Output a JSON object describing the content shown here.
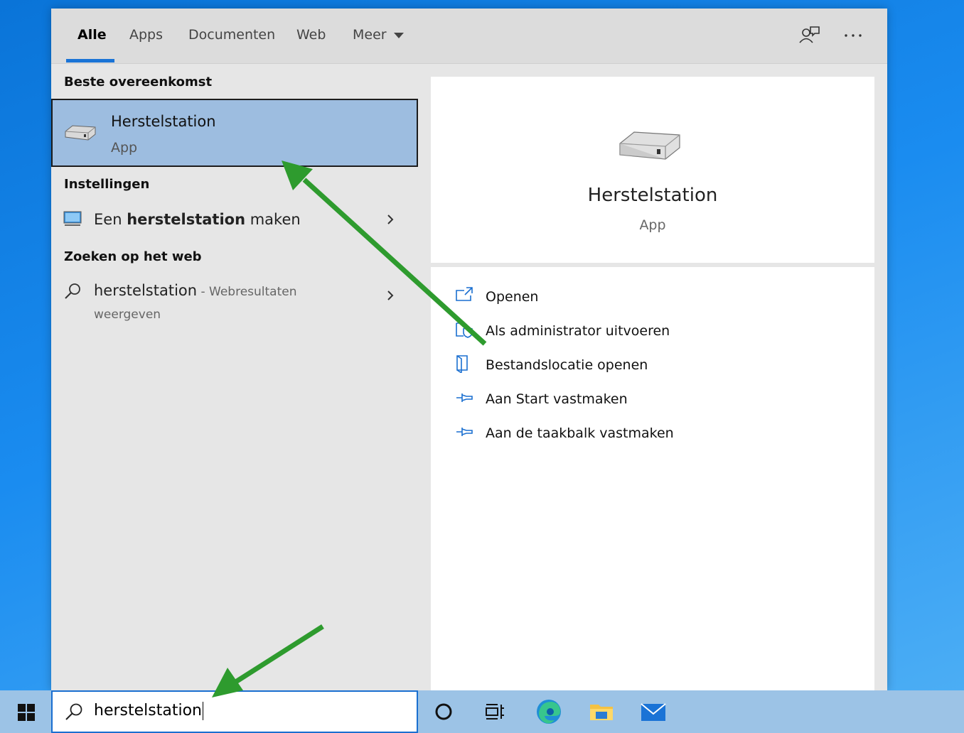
{
  "tabs": [
    {
      "label": "Alle"
    },
    {
      "label": "Apps"
    },
    {
      "label": "Documenten"
    },
    {
      "label": "Web"
    },
    {
      "label": "Meer"
    }
  ],
  "sections": {
    "best_match": "Beste overeenkomst",
    "settings": "Instellingen",
    "web": "Zoeken op het web"
  },
  "best_result": {
    "title": "Herstelstation",
    "subtitle": "App"
  },
  "settings_result": {
    "prefix": "Een ",
    "bold": "herstelstation",
    "suffix": " maken"
  },
  "web_result": {
    "query": "herstelstation",
    "separator": " - ",
    "note": "Webresultaten",
    "note_line2": "weergeven"
  },
  "preview": {
    "title": "Herstelstation",
    "subtitle": "App"
  },
  "actions": [
    {
      "label": "Openen",
      "icon": "open-icon"
    },
    {
      "label": "Als administrator uitvoeren",
      "icon": "shield-icon"
    },
    {
      "label": "Bestandslocatie openen",
      "icon": "file-location-icon"
    },
    {
      "label": "Aan Start vastmaken",
      "icon": "pin-icon"
    },
    {
      "label": "Aan de taakbalk vastmaken",
      "icon": "pin-icon"
    }
  ],
  "search": {
    "value": "herstelstation"
  },
  "colors": {
    "accent": "#1a73d6",
    "selection": "#9dbde0",
    "annotation_arrow": "#2e9b2e"
  }
}
